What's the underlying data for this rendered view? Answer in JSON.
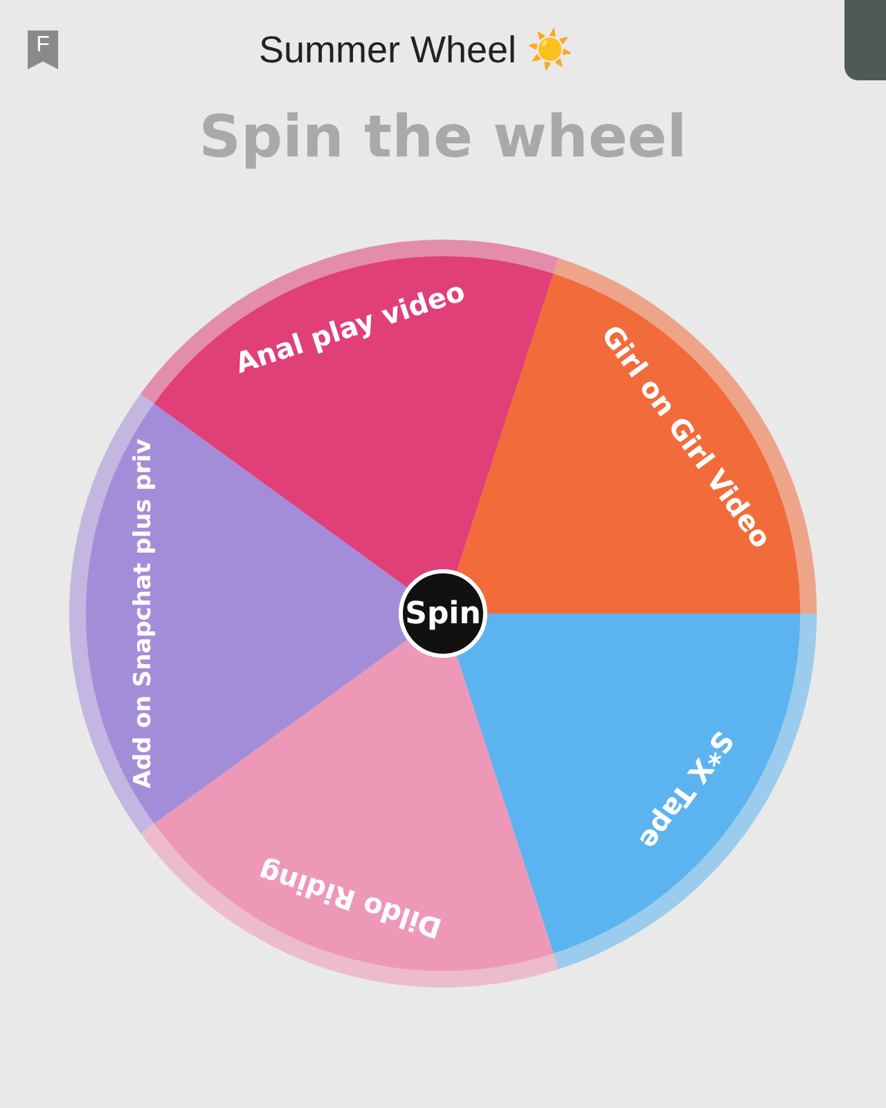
{
  "header": {
    "badge": "F",
    "title": "Summer Wheel ☀️"
  },
  "heading": "Spin the wheel",
  "wheel": {
    "segments": [
      {
        "label": "S*X Tape",
        "color": "#5bb4f0"
      },
      {
        "label": "Dildo Riding",
        "color": "#ee98b8"
      },
      {
        "label": "Add on Snapchat plus priv",
        "color": "#a48dd8"
      },
      {
        "label": "Anal play video",
        "color": "#e03f78"
      },
      {
        "label": "Girl on Girl Video",
        "color": "#f26b3a"
      }
    ],
    "spin_button": "Spin"
  }
}
